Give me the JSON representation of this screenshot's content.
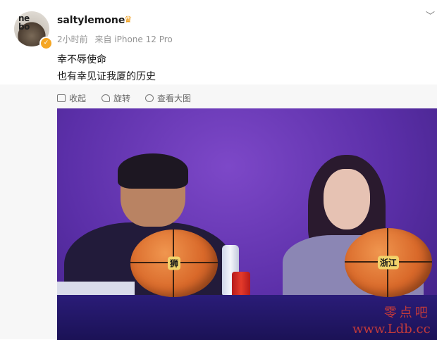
{
  "post": {
    "username": "saltylemone",
    "avatar_text": "ne\nbo",
    "time": "2小时前",
    "source": "来自 iPhone 12 Pro",
    "lines": [
      "幸不辱使命",
      "也有幸见证我厦的历史"
    ]
  },
  "toolbar": {
    "collapse_label": "收起",
    "rotate_label": "旋转",
    "view_large_label": "查看大图"
  },
  "photo": {
    "ball_left_logo": "狮",
    "ball_right_logo": "浙江"
  },
  "watermark": {
    "line1": "零点吧",
    "line2": "www.Ldb.cc"
  },
  "icons": {
    "crown": "crown-icon",
    "verified": "verified-badge-icon",
    "chevron": "chevron-down-icon"
  },
  "colors": {
    "verified": "#f5a623",
    "watermark": "#c23a3a",
    "meta_text": "#939393"
  }
}
